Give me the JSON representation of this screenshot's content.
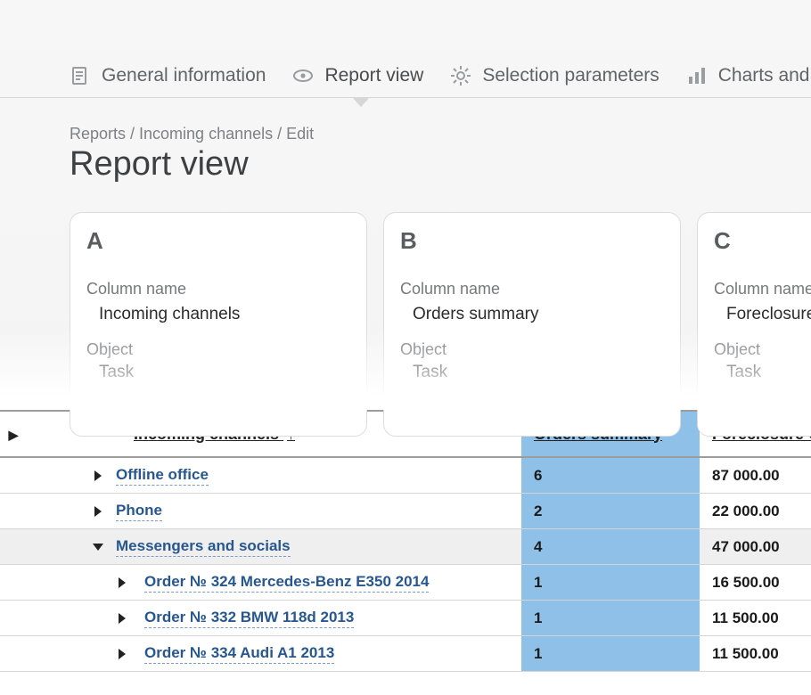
{
  "tabs": [
    {
      "label": "General information"
    },
    {
      "label": "Report view"
    },
    {
      "label": "Selection parameters"
    },
    {
      "label": "Charts and gr"
    }
  ],
  "breadcrumb": "Reports / Incoming channels / Edit",
  "page_title": "Report view",
  "columns": [
    {
      "letter": "A",
      "name_label": "Column name",
      "name_value": "Incoming channels",
      "object_label": "Object",
      "object_value": "Task"
    },
    {
      "letter": "B",
      "name_label": "Column name",
      "name_value": "Orders summary",
      "object_label": "Object",
      "object_value": "Task"
    },
    {
      "letter": "C",
      "name_label": "Column name",
      "name_value": "Foreclosure Co",
      "object_label": "Object",
      "object_value": "Task"
    }
  ],
  "table": {
    "headers": {
      "c1": "Incoming channels",
      "sort_arrow": "↑",
      "c2": "Orders summary",
      "c3": "Foreclosure Co"
    },
    "rows": [
      {
        "depth": 1,
        "expanded": false,
        "label": "Offline office",
        "orders": "6",
        "foreclosure": "87 000.00"
      },
      {
        "depth": 1,
        "expanded": false,
        "label": "Phone",
        "orders": "2",
        "foreclosure": "22 000.00"
      },
      {
        "depth": 1,
        "expanded": true,
        "label": "Messengers and socials",
        "orders": "4",
        "foreclosure": "47 000.00"
      },
      {
        "depth": 2,
        "expanded": false,
        "label": "Order № 324 Mercedes-Benz E350 2014",
        "orders": "1",
        "foreclosure": "16 500.00"
      },
      {
        "depth": 2,
        "expanded": false,
        "label": "Order № 332 BMW 118d 2013",
        "orders": "1",
        "foreclosure": "11 500.00"
      },
      {
        "depth": 2,
        "expanded": false,
        "label": "Order № 334 Audi A1 2013",
        "orders": "1",
        "foreclosure": "11 500.00"
      }
    ]
  }
}
